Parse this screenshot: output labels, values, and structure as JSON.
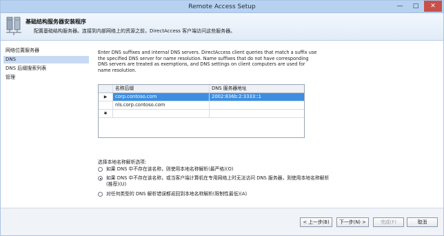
{
  "window": {
    "title": "Remote Access Setup",
    "controls": {
      "minimize": "—",
      "maximize": "□",
      "close": "✕"
    }
  },
  "header": {
    "title": "基础结构服务器安装程序",
    "subtitle": "配置基础结构服务器。连接到内部网络上的资源之前，DirectAccess 客户端访问这些服务器。",
    "icon": "server-network-icon"
  },
  "nav": {
    "items": [
      {
        "label": "网络位置服务器",
        "active": false
      },
      {
        "label": "DNS",
        "active": true
      },
      {
        "label": "DNS 后缀搜索列表",
        "active": false
      },
      {
        "label": "管理",
        "active": false
      }
    ]
  },
  "main": {
    "description": "Enter DNS suffixes and internal DNS servers.  DirectAccess client queries that match a suffix use the specified DNS server for name resolution. Name suffixes that do not have corresponding DNS servers are treated as exemptions, and DNS settings on client computers are used for name resolution."
  },
  "grid": {
    "columns": [
      "名称后缀",
      "DNS 服务器地址"
    ],
    "rows": [
      {
        "marker": "▶",
        "suffix": "corp.contoso.com",
        "address": "2002:836b:2:3333::1"
      },
      {
        "marker": "",
        "suffix": "nls.corp.contoso.com",
        "address": ""
      },
      {
        "marker": "✱",
        "suffix": "",
        "address": ""
      }
    ]
  },
  "options": {
    "title": "选择本地名称解析选项:",
    "items": [
      {
        "label": "如果 DNS 中不存在该名称，则使用本地名称解析(最严格)(O)",
        "checked": false
      },
      {
        "label": "如果 DNS 中不存在该名称，或当客户端计算机在专用网络上时无法访问 DNS 服务器，则使用本地名称解析(推荐)(U)",
        "checked": true
      },
      {
        "label": "对任何类型的 DNS 解析错误都返回到本地名称解析(限制性最低)(A)",
        "checked": false
      }
    ]
  },
  "footer": {
    "back": "< 上一步(B)",
    "next": "下一步(N) >",
    "finish": "完成(F)",
    "cancel": "取消"
  }
}
